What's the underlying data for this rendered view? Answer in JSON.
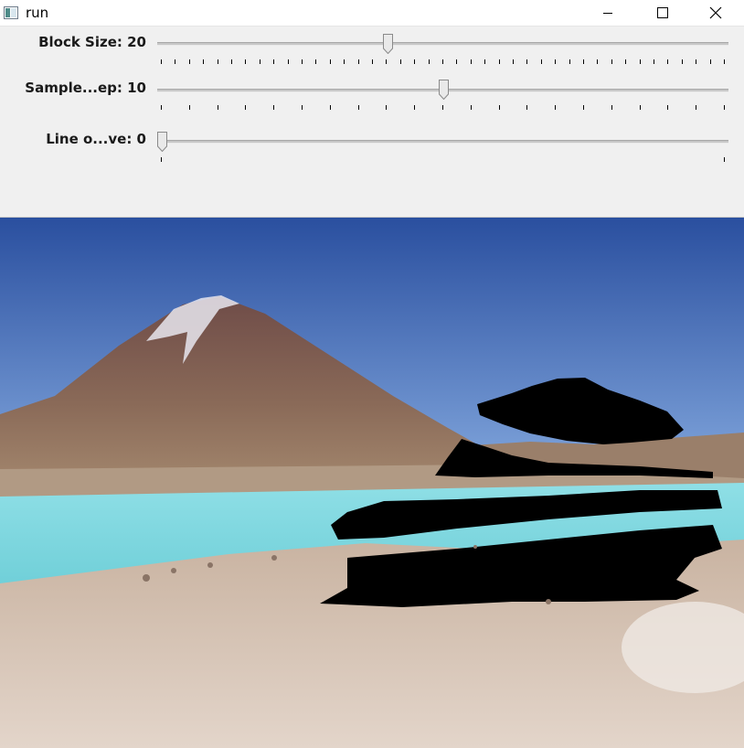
{
  "window": {
    "title": "run",
    "minimize_icon": "minimize-icon",
    "maximize_icon": "maximize-icon",
    "close_icon": "close-icon"
  },
  "trackbars": [
    {
      "label": "Block Size: 20",
      "value": 20,
      "position_fraction": 0.4
    },
    {
      "label": "Sample...ep: 10",
      "value": 10,
      "position_fraction": 0.5
    },
    {
      "label": "Line o...ve: 0",
      "value": 0,
      "position_fraction": 0.0
    }
  ],
  "image": {
    "description_icon": "landscape-image",
    "colors": {
      "sky_top": "#2a4f9f",
      "sky_bottom": "#7fa8df",
      "mountain": "#7a5a52",
      "lagoon": "#7fd6dc",
      "ground": "#d9c7b8",
      "mask": "#000000"
    }
  }
}
